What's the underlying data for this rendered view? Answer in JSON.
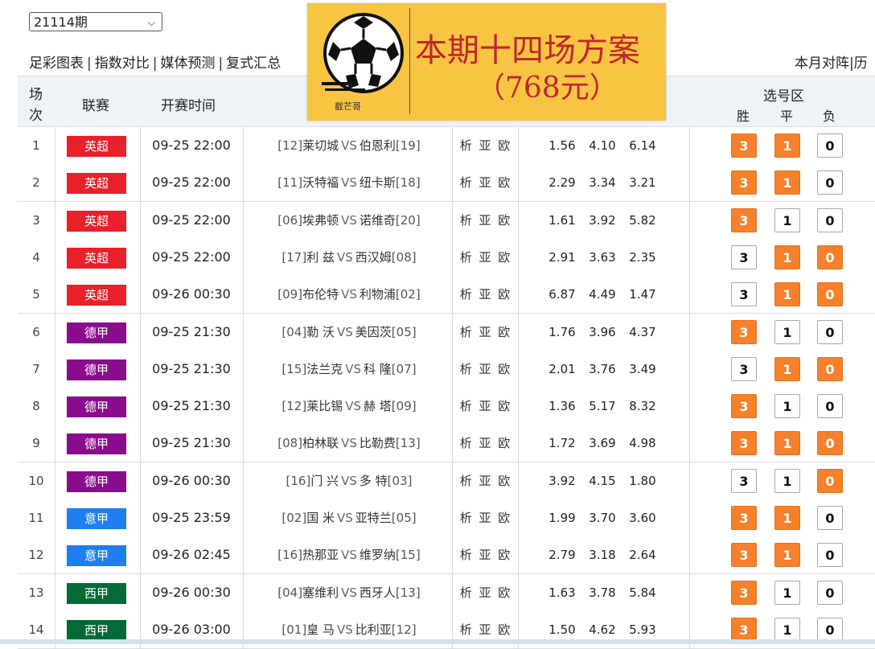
{
  "toolbar": {
    "period_select": "21114期",
    "links": [
      "足彩图表",
      "指数对比",
      "媒体预测",
      "复式汇总"
    ],
    "separator": "|",
    "right_links": [
      "本月对阵",
      "历"
    ]
  },
  "banner": {
    "brand": "截芒哥",
    "title_line1": "本期十四场方案",
    "title_line2": "（768元）"
  },
  "table": {
    "headers": {
      "index_top": "场",
      "index_bottom": "次",
      "league": "联赛",
      "start_time": "开赛时间",
      "pick_area": "选号区",
      "win": "胜",
      "draw": "平",
      "loss": "负"
    },
    "link_text": "析 亚 欧",
    "vs": "VS",
    "rows": [
      {
        "no": "1",
        "league": "英超",
        "league_color": "#e8212b",
        "time": "09-25 22:00",
        "home_rank": "[12]",
        "home": "莱切城",
        "away": "伯恩利",
        "away_rank": "[19]",
        "odds": [
          "1.56",
          "4.10",
          "6.14"
        ],
        "picks": [
          "3",
          "1",
          "0"
        ],
        "selected": [
          true,
          true,
          false
        ]
      },
      {
        "no": "2",
        "league": "英超",
        "league_color": "#e8212b",
        "time": "09-25 22:00",
        "home_rank": "[11]",
        "home": "沃特福",
        "away": "纽卡斯",
        "away_rank": "[18]",
        "odds": [
          "2.29",
          "3.34",
          "3.21"
        ],
        "picks": [
          "3",
          "1",
          "0"
        ],
        "selected": [
          true,
          true,
          false
        ]
      },
      {
        "no": "3",
        "league": "英超",
        "league_color": "#e8212b",
        "time": "09-25 22:00",
        "home_rank": "[06]",
        "home": "埃弗顿",
        "away": "诺维奇",
        "away_rank": "[20]",
        "odds": [
          "1.61",
          "3.92",
          "5.82"
        ],
        "picks": [
          "3",
          "1",
          "0"
        ],
        "selected": [
          true,
          false,
          false
        ]
      },
      {
        "no": "4",
        "league": "英超",
        "league_color": "#e8212b",
        "time": "09-25 22:00",
        "home_rank": "[17]",
        "home": "利 兹",
        "away": "西汉姆",
        "away_rank": "[08]",
        "odds": [
          "2.91",
          "3.63",
          "2.35"
        ],
        "picks": [
          "3",
          "1",
          "0"
        ],
        "selected": [
          false,
          true,
          true
        ]
      },
      {
        "no": "5",
        "league": "英超",
        "league_color": "#e8212b",
        "time": "09-26 00:30",
        "home_rank": "[09]",
        "home": "布伦特",
        "away": "利物浦",
        "away_rank": "[02]",
        "odds": [
          "6.87",
          "4.49",
          "1.47"
        ],
        "picks": [
          "3",
          "1",
          "0"
        ],
        "selected": [
          false,
          true,
          true
        ]
      },
      {
        "no": "6",
        "league": "德甲",
        "league_color": "#8b0c8e",
        "time": "09-25 21:30",
        "home_rank": "[04]",
        "home": "勒 沃",
        "away": "美因茨",
        "away_rank": "[05]",
        "odds": [
          "1.76",
          "3.96",
          "4.37"
        ],
        "picks": [
          "3",
          "1",
          "0"
        ],
        "selected": [
          true,
          false,
          false
        ]
      },
      {
        "no": "7",
        "league": "德甲",
        "league_color": "#8b0c8e",
        "time": "09-25 21:30",
        "home_rank": "[15]",
        "home": "法兰克",
        "away": "科 隆",
        "away_rank": "[07]",
        "odds": [
          "2.01",
          "3.76",
          "3.49"
        ],
        "picks": [
          "3",
          "1",
          "0"
        ],
        "selected": [
          false,
          true,
          true
        ]
      },
      {
        "no": "8",
        "league": "德甲",
        "league_color": "#8b0c8e",
        "time": "09-25 21:30",
        "home_rank": "[12]",
        "home": "莱比锡",
        "away": "赫 塔",
        "away_rank": "[09]",
        "odds": [
          "1.36",
          "5.17",
          "8.32"
        ],
        "picks": [
          "3",
          "1",
          "0"
        ],
        "selected": [
          true,
          false,
          false
        ]
      },
      {
        "no": "9",
        "league": "德甲",
        "league_color": "#8b0c8e",
        "time": "09-25 21:30",
        "home_rank": "[08]",
        "home": "柏林联",
        "away": "比勒费",
        "away_rank": "[13]",
        "odds": [
          "1.72",
          "3.69",
          "4.98"
        ],
        "picks": [
          "3",
          "1",
          "0"
        ],
        "selected": [
          true,
          true,
          true
        ]
      },
      {
        "no": "10",
        "league": "德甲",
        "league_color": "#8b0c8e",
        "time": "09-26 00:30",
        "home_rank": "[16]",
        "home": "门 兴",
        "away": "多 特",
        "away_rank": "[03]",
        "odds": [
          "3.92",
          "4.15",
          "1.80"
        ],
        "picks": [
          "3",
          "1",
          "0"
        ],
        "selected": [
          false,
          false,
          true
        ]
      },
      {
        "no": "11",
        "league": "意甲",
        "league_color": "#1e7ff0",
        "time": "09-25 23:59",
        "home_rank": "[02]",
        "home": "国 米",
        "away": "亚特兰",
        "away_rank": "[05]",
        "odds": [
          "1.99",
          "3.70",
          "3.60"
        ],
        "picks": [
          "3",
          "1",
          "0"
        ],
        "selected": [
          true,
          true,
          false
        ]
      },
      {
        "no": "12",
        "league": "意甲",
        "league_color": "#1e7ff0",
        "time": "09-26 02:45",
        "home_rank": "[16]",
        "home": "热那亚",
        "away": "维罗纳",
        "away_rank": "[15]",
        "odds": [
          "2.79",
          "3.18",
          "2.64"
        ],
        "picks": [
          "3",
          "1",
          "0"
        ],
        "selected": [
          true,
          true,
          false
        ]
      },
      {
        "no": "13",
        "league": "西甲",
        "league_color": "#056a35",
        "time": "09-26 00:30",
        "home_rank": "[04]",
        "home": "塞维利",
        "away": "西牙人",
        "away_rank": "[13]",
        "odds": [
          "1.63",
          "3.78",
          "5.84"
        ],
        "picks": [
          "3",
          "1",
          "0"
        ],
        "selected": [
          true,
          false,
          false
        ]
      },
      {
        "no": "14",
        "league": "西甲",
        "league_color": "#056a35",
        "time": "09-26 03:00",
        "home_rank": "[01]",
        "home": "皇 马",
        "away": "比利亚",
        "away_rank": "[12]",
        "odds": [
          "1.50",
          "4.62",
          "5.93"
        ],
        "picks": [
          "3",
          "1",
          "0"
        ],
        "selected": [
          true,
          false,
          false
        ]
      }
    ]
  }
}
